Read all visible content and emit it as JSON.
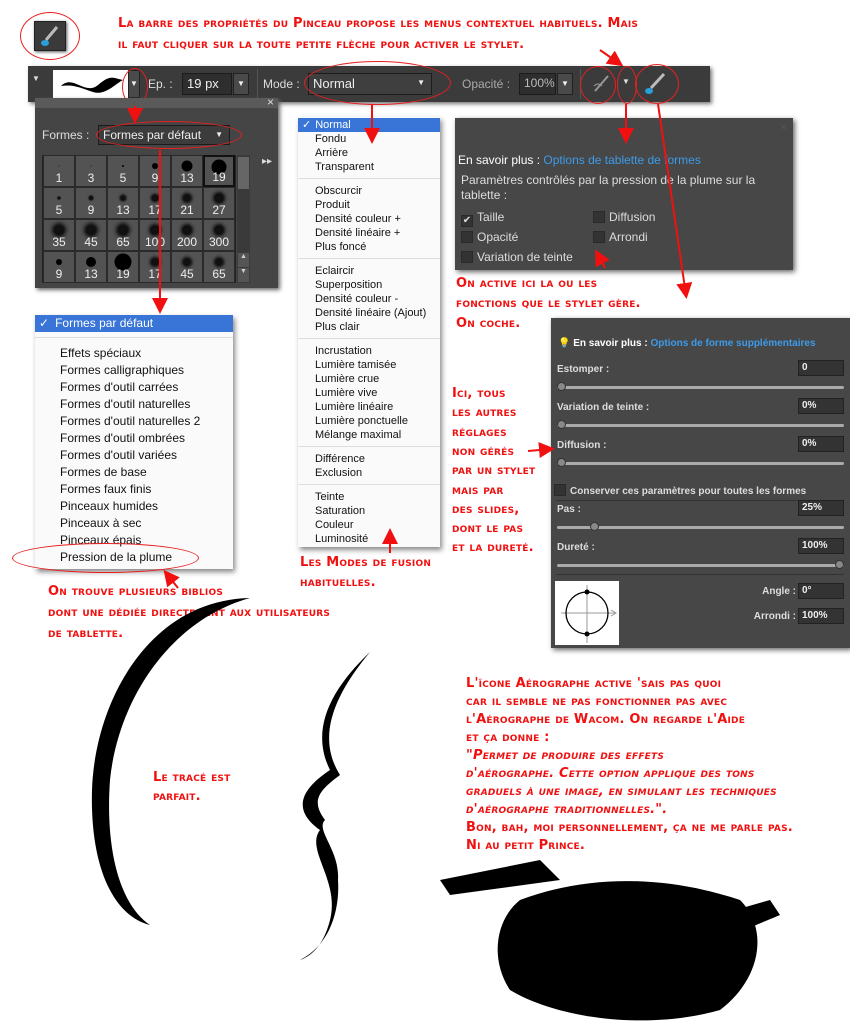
{
  "annotations": {
    "top": [
      "La barre des propriétés du Pinceau propose les menus contextuel habituels. Mais",
      "il faut cliquer sur la toute petite flèche pour activer le stylet."
    ],
    "biblios": [
      "On trouve plusieurs biblios",
      "dont une dédiée directement aux utilisateurs",
      "de tablette."
    ],
    "modes": [
      "Les Modes de fusion",
      "habituelles."
    ],
    "active": [
      "On active ici la ou les",
      "fonctions que le stylet gère.",
      "On coche."
    ],
    "ici": [
      "Ici, tous",
      "les autres",
      "réglages",
      "non gérés",
      "par un stylet",
      "mais par",
      "des slides,",
      "dont le pas",
      "et la dureté."
    ],
    "trace": [
      "Le tracé est",
      "parfait."
    ],
    "aero": [
      "L'îcone Aérographe active 'sais pas quoi",
      "car il semble ne pas fonctionner pas avec",
      "l'Aérographe de Wacom.  On regarde l'Aide",
      "et ça donne :"
    ],
    "aero_quote": [
      "\"Permet de produire des effets",
      "d'aérographe. Cette option applique des tons",
      "graduels à une image, en simulant les techniques",
      "d'aérographe traditionnelles.\"."
    ],
    "aero_end": [
      "Bon, bah, moi personnellement, ça ne me parle pas.",
      "Ni au petit Prince."
    ]
  },
  "toolbar": {
    "size_label": "Ep. :",
    "size_value": "19 px",
    "mode_label": "Mode :",
    "mode_value": "Normal",
    "opacity_label": "Opacité :",
    "opacity_value": "100%"
  },
  "brush_panel": {
    "formes_label": "Formes :",
    "formes_value": "Formes par défaut",
    "close": "×",
    "more": "▸▸",
    "sizes": [
      "1",
      "3",
      "5",
      "9",
      "13",
      "19",
      "5",
      "9",
      "13",
      "17",
      "21",
      "27",
      "35",
      "45",
      "65",
      "100",
      "200",
      "300",
      "9",
      "13",
      "19",
      "17",
      "45",
      "65"
    ],
    "selected_index": 5
  },
  "mode_menu": {
    "groups": [
      [
        "Normal",
        "Fondu",
        "Arrière",
        "Transparent"
      ],
      [
        "Obscurcir",
        "Produit",
        "Densité couleur +",
        "Densité linéaire +",
        "Plus foncé"
      ],
      [
        "Eclaircir",
        "Superposition",
        "Densité couleur -",
        "Densité linéaire (Ajout)",
        "Plus clair"
      ],
      [
        "Incrustation",
        "Lumière tamisée",
        "Lumière crue",
        "Lumière vive",
        "Lumière linéaire",
        "Lumière ponctuelle",
        "Mélange maximal"
      ],
      [
        "Différence",
        "Exclusion"
      ],
      [
        "Teinte",
        "Saturation",
        "Couleur",
        "Luminosité"
      ]
    ],
    "selected": "Normal",
    "check": "✓"
  },
  "shapes_menu": {
    "selected": "Formes par défaut",
    "check": "✓",
    "items": [
      "Effets  spéciaux",
      "Formes calligraphiques",
      "Formes d'outil carrées",
      "Formes d'outil naturelles",
      "Formes d'outil naturelles 2",
      "Formes d'outil ombrées",
      "Formes d'outil variées",
      "Formes de base",
      "Formes faux finis",
      "Pinceaux humides",
      "Pinceaux à sec",
      "Pinceaux épais",
      "Pression de la plume"
    ]
  },
  "tablet_panel": {
    "learn": "En savoir plus :",
    "link": "Options de tablette de formes",
    "desc": "Paramètres contrôlés par la pression de la plume sur la tablette :",
    "options": [
      {
        "label": "Taille",
        "checked": true
      },
      {
        "label": "Diffusion",
        "checked": false
      },
      {
        "label": "Opacité",
        "checked": false
      },
      {
        "label": "Arrondi",
        "checked": false
      },
      {
        "label": "Variation de teinte",
        "checked": false
      }
    ]
  },
  "options_panel": {
    "learn": "En savoir plus :",
    "link": "Options de forme supplémentaires",
    "sliders": [
      {
        "label": "Estomper :",
        "value": "0",
        "level": 0
      },
      {
        "label": "Variation de teinte :",
        "value": "0%",
        "level": 0
      },
      {
        "label": "Diffusion :",
        "value": "0%",
        "level": 0
      }
    ],
    "keep": "Conserver ces paramètres pour toutes les formes",
    "sliders2": [
      {
        "label": "Pas :",
        "value": "25%",
        "level": 0.12
      },
      {
        "label": "Dureté :",
        "value": "100%",
        "level": 1
      }
    ],
    "angle_label": "Angle :",
    "angle_value": "0°",
    "round_label": "Arrondi :",
    "round_value": "100%"
  },
  "colors": {
    "annotation": "#f01010",
    "panel": "#474747",
    "link": "#3d9be9",
    "menu_highlight": "#3875d7"
  }
}
